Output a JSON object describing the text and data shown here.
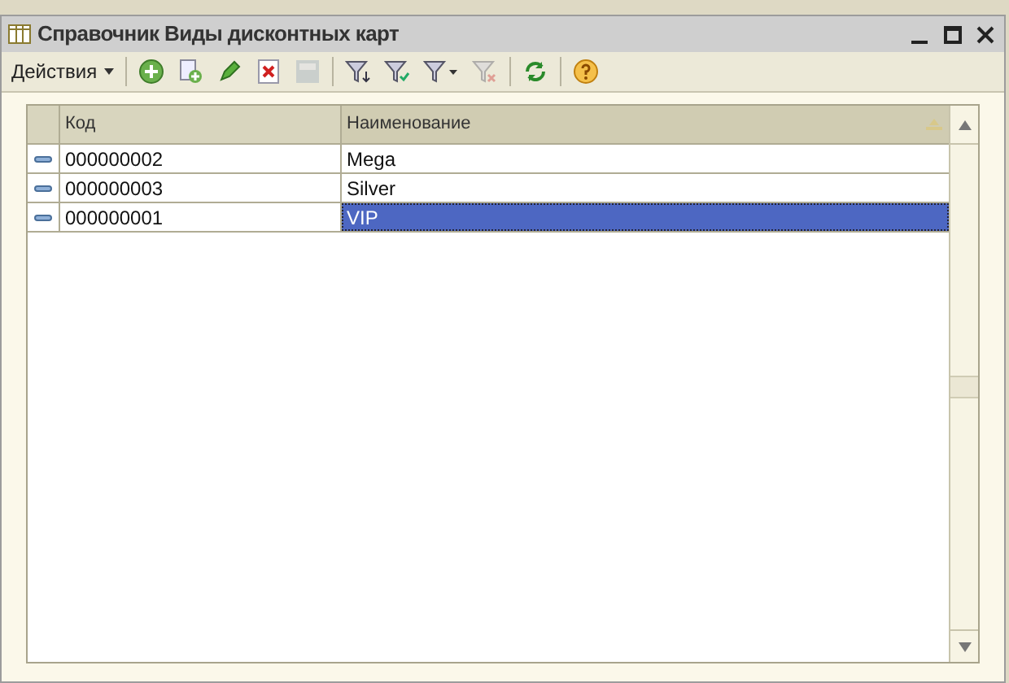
{
  "window": {
    "title": "Справочник Виды дисконтных карт"
  },
  "toolbar": [
    {
      "kind": "menu",
      "label": "Действия"
    },
    {
      "kind": "add",
      "disabled": false
    },
    {
      "kind": "copy",
      "disabled": false
    },
    {
      "kind": "edit",
      "disabled": false
    },
    {
      "kind": "delete",
      "disabled": false
    },
    {
      "kind": "save",
      "disabled": true
    },
    {
      "kind": "filter",
      "disabled": false
    },
    {
      "kind": "filter-check",
      "disabled": false
    },
    {
      "kind": "filter-menu",
      "disabled": false
    },
    {
      "kind": "filter-clear",
      "disabled": true
    },
    {
      "kind": "refresh",
      "disabled": false
    },
    {
      "kind": "help",
      "disabled": false
    }
  ],
  "table": {
    "columns": [
      "Код",
      "Наименование"
    ],
    "rows": [
      {
        "code": "000000002",
        "name": "Mega",
        "selected": false
      },
      {
        "code": "000000003",
        "name": "Silver",
        "selected": false
      },
      {
        "code": "000000001",
        "name": "VIP",
        "selected": true
      }
    ]
  }
}
